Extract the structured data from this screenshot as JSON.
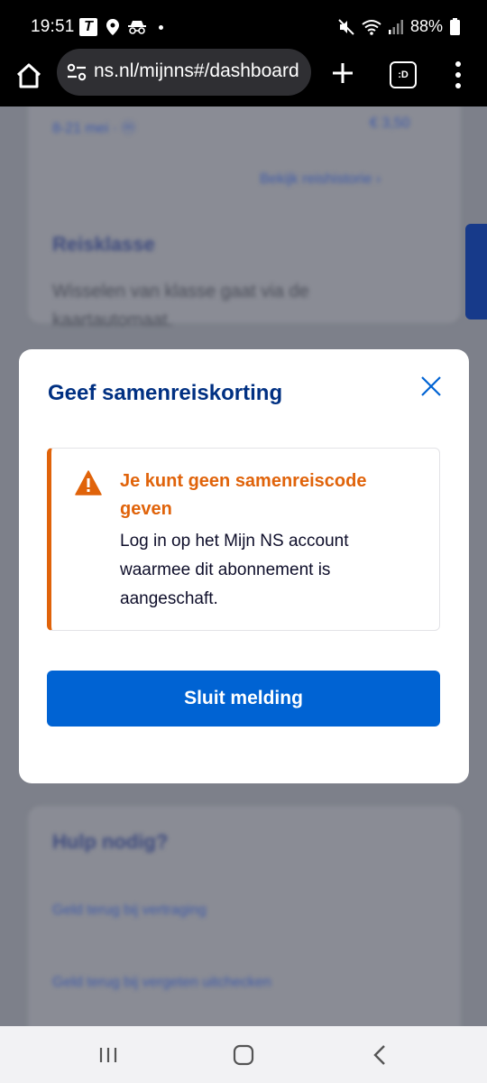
{
  "status_bar": {
    "time": "19:51",
    "battery": "88%",
    "icons": [
      "t-app-icon",
      "location-icon",
      "incognito-icon",
      "mute-icon",
      "wifi-icon",
      "signal-icon",
      "battery-icon"
    ]
  },
  "browser": {
    "url": "ns.nl/mijnns#/dashboard",
    "tabs_label": ":D"
  },
  "background": {
    "row_text": "8-21 mei · ⓜ",
    "row_price": "€ 3,50",
    "link_more": "Bekijk reishistorie  ›",
    "section_title": "Reisklasse",
    "section_text_1": "Wisselen van klasse gaat via de",
    "section_text_2": "kaartautomaat.",
    "help_title": "Hulp nodig?",
    "help_link_1": "Geld terug bij vertraging",
    "help_link_2": "Geld terug bij vergeten uitchecken"
  },
  "modal": {
    "title": "Geef samenreiskorting",
    "alert_title": "Je kunt geen samenreiscode geven",
    "alert_body": "Log in op het Mijn NS account waarmee dit abonnement is aangeschaft.",
    "button_label": "Sluit melding"
  },
  "colors": {
    "ns_blue": "#003082",
    "button_blue": "#0063d3",
    "warning_orange": "#e0630a"
  }
}
